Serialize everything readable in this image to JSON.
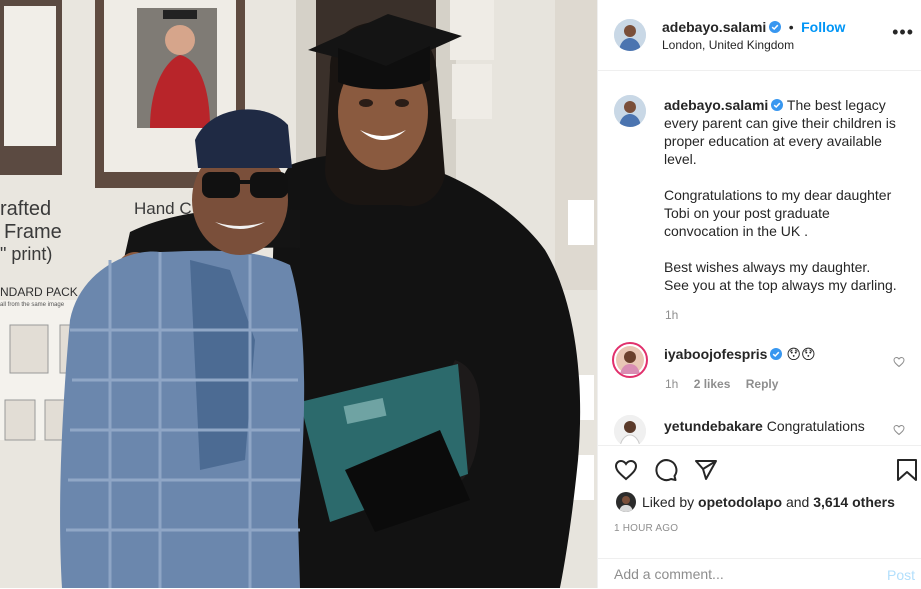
{
  "post": {
    "username": "adebayo.salami",
    "follow_label": "Follow",
    "location": "London, United Kingdom",
    "more_label": "•••"
  },
  "caption": {
    "username": "adebayo.salami",
    "line1": "The best legacy every parent can give their children is proper education at every available level.",
    "line2": "Congratulations to my dear daughter Tobi on your post graduate convocation in the UK .",
    "line3": "Best wishes always my daughter.",
    "line4": "See you at the top always my darling.",
    "time": "1h"
  },
  "comments": [
    {
      "username": "iyaboojofespris",
      "text": "😯😯",
      "time": "1h",
      "likes": "2 likes",
      "reply": "Reply"
    },
    {
      "username": "yetundebakare",
      "text": "Congratulations"
    }
  ],
  "likes": {
    "prefix": "Liked by",
    "user": "opetodolapo",
    "joiner": "and",
    "count": "3,614 others"
  },
  "timestamp": "1 HOUR AGO",
  "add_comment": {
    "placeholder": "Add a comment...",
    "post_label": "Post"
  },
  "photo_signage": {
    "crafted": "rafted",
    "frame": "Frame",
    "print": "\" print)",
    "hand": "Hand C",
    "pack": "NDARD PACK",
    "pack_sub": "all from the same image"
  },
  "colors": {
    "accent": "#0095f6",
    "muted": "#8e8e8e",
    "gown": "#111111",
    "agbada": "#5d7ea8"
  }
}
